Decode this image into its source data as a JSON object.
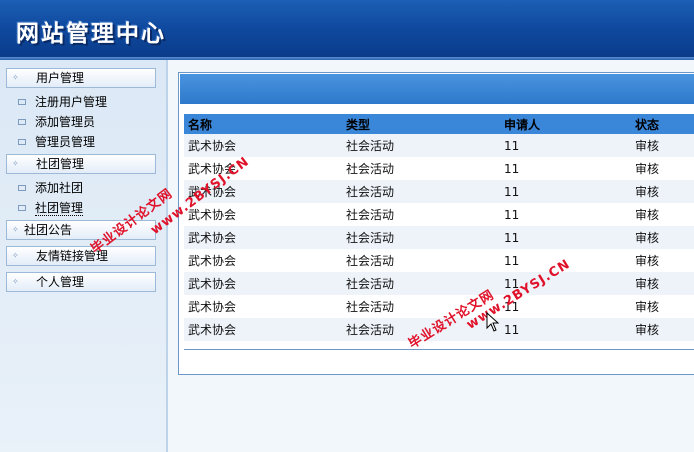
{
  "header": {
    "title": "网站管理中心"
  },
  "sidebar": {
    "groups": [
      {
        "label": "用户管理",
        "items": [
          "注册用户管理",
          "添加管理员",
          "管理员管理"
        ]
      },
      {
        "label": "社团管理",
        "items": [
          "添加社团",
          "社团管理"
        ]
      },
      {
        "label": "社团公告",
        "items": []
      },
      {
        "label": "友情链接管理",
        "items": []
      },
      {
        "label": "个人管理",
        "items": []
      }
    ]
  },
  "table": {
    "headers": [
      "名称",
      "类型",
      "申请人",
      "状态"
    ],
    "rows": [
      [
        "武术协会",
        "社会活动",
        "11",
        "审核"
      ],
      [
        "武术协会",
        "社会活动",
        "11",
        "审核"
      ],
      [
        "武术协会",
        "社会活动",
        "11",
        "审核"
      ],
      [
        "武术协会",
        "社会活动",
        "11",
        "审核"
      ],
      [
        "武术协会",
        "社会活动",
        "11",
        "审核"
      ],
      [
        "武术协会",
        "社会活动",
        "11",
        "审核"
      ],
      [
        "武术协会",
        "社会活动",
        "11",
        "审核"
      ],
      [
        "武术协会",
        "社会活动",
        "11",
        "审核"
      ],
      [
        "武术协会",
        "社会活动",
        "11",
        "审核"
      ]
    ]
  },
  "watermarks": {
    "line1": "毕业设计论文网",
    "line2": "www.2BYSJ.CN"
  },
  "colors": {
    "header_blue": "#0f4aa0",
    "table_header": "#3a86d8",
    "watermark_red": "#e0122a"
  }
}
